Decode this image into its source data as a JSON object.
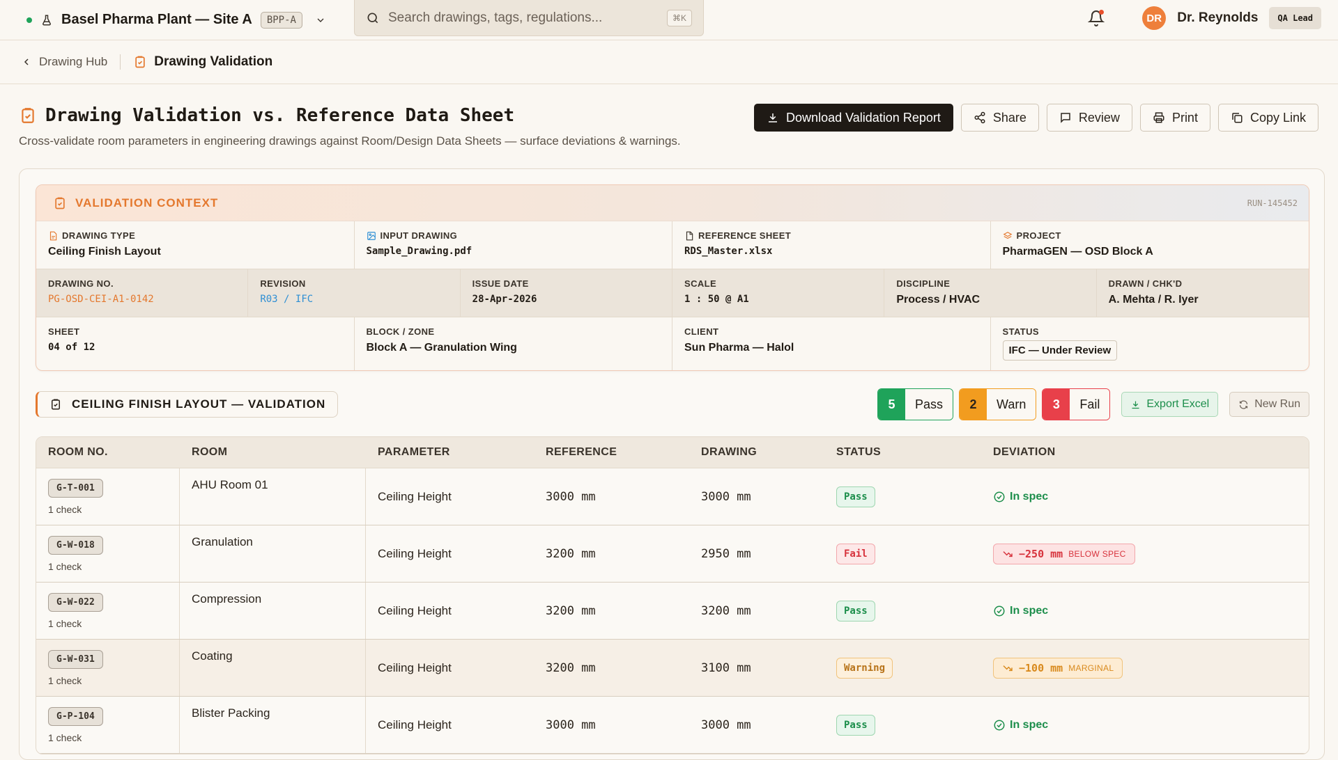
{
  "topbar": {
    "site_name": "Basel Pharma Plant — Site A",
    "site_code": "BPP-A",
    "search_placeholder": "Search drawings, tags, regulations...",
    "search_shortcut": "⌘K",
    "user_initials": "DR",
    "user_name": "Dr. Reynolds",
    "user_role": "QA Lead"
  },
  "breadcrumb": {
    "back_label": "Drawing Hub",
    "current_label": "Drawing Validation"
  },
  "page": {
    "title": "Drawing Validation vs. Reference Data Sheet",
    "subtitle": "Cross-validate room parameters in engineering drawings against Room/Design Data Sheets — surface deviations & warnings."
  },
  "actions": {
    "download": "Download Validation Report",
    "share": "Share",
    "review": "Review",
    "print": "Print",
    "copy_link": "Copy Link"
  },
  "context": {
    "title": "VALIDATION CONTEXT",
    "run_id": "RUN-145452",
    "drawing_type_label": "DRAWING TYPE",
    "drawing_type": "Ceiling Finish Layout",
    "input_drawing_label": "INPUT DRAWING",
    "input_drawing": "Sample_Drawing.pdf",
    "reference_sheet_label": "REFERENCE SHEET",
    "reference_sheet": "RDS_Master.xlsx",
    "project_label": "PROJECT",
    "project": "PharmaGEN — OSD Block A",
    "drawing_no_label": "DRAWING NO.",
    "drawing_no": "PG-OSD-CEI-A1-0142",
    "revision_label": "REVISION",
    "revision": "R03 / IFC",
    "issue_date_label": "ISSUE DATE",
    "issue_date": "28-Apr-2026",
    "scale_label": "SCALE",
    "scale": "1 : 50 @ A1",
    "discipline_label": "DISCIPLINE",
    "discipline": "Process / HVAC",
    "drawn_label": "DRAWN / CHK'D",
    "drawn": "A. Mehta / R. Iyer",
    "sheet_label": "SHEET",
    "sheet": "04 of 12",
    "block_label": "BLOCK / ZONE",
    "block": "Block A — Granulation Wing",
    "client_label": "CLIENT",
    "client": "Sun Pharma — Halol",
    "status_label": "STATUS",
    "status": "IFC — Under Review"
  },
  "section": {
    "title": "CEILING FINISH LAYOUT — VALIDATION",
    "pass_count": "5",
    "pass_label": "Pass",
    "warn_count": "2",
    "warn_label": "Warn",
    "fail_count": "3",
    "fail_label": "Fail",
    "export_label": "Export Excel",
    "new_run_label": "New Run"
  },
  "table": {
    "headers": [
      "ROOM NO.",
      "ROOM",
      "PARAMETER",
      "REFERENCE",
      "DRAWING",
      "STATUS",
      "DEVIATION"
    ],
    "rows": [
      {
        "room_no": "G-T-001",
        "checks": "1 check",
        "room": "AHU Room 01",
        "parameter": "Ceiling Height",
        "reference": "3000 mm",
        "drawing": "3000 mm",
        "status": "Pass",
        "deviation": "In spec",
        "deviation_note": ""
      },
      {
        "room_no": "G-W-018",
        "checks": "1 check",
        "room": "Granulation",
        "parameter": "Ceiling Height",
        "reference": "3200 mm",
        "drawing": "2950 mm",
        "status": "Fail",
        "deviation": "−250 mm",
        "deviation_note": "BELOW SPEC"
      },
      {
        "room_no": "G-W-022",
        "checks": "1 check",
        "room": "Compression",
        "parameter": "Ceiling Height",
        "reference": "3200 mm",
        "drawing": "3200 mm",
        "status": "Pass",
        "deviation": "In spec",
        "deviation_note": ""
      },
      {
        "room_no": "G-W-031",
        "checks": "1 check",
        "room": "Coating",
        "parameter": "Ceiling Height",
        "reference": "3200 mm",
        "drawing": "3100 mm",
        "status": "Warning",
        "deviation": "−100 mm",
        "deviation_note": "MARGINAL"
      },
      {
        "room_no": "G-P-104",
        "checks": "1 check",
        "room": "Blister Packing",
        "parameter": "Ceiling Height",
        "reference": "3000 mm",
        "drawing": "3000 mm",
        "status": "Pass",
        "deviation": "In spec",
        "deviation_note": ""
      }
    ]
  },
  "colors": {
    "accent": "#e4782e",
    "pass": "#1fa35a",
    "warn": "#f29c1f",
    "fail": "#e8404a"
  }
}
